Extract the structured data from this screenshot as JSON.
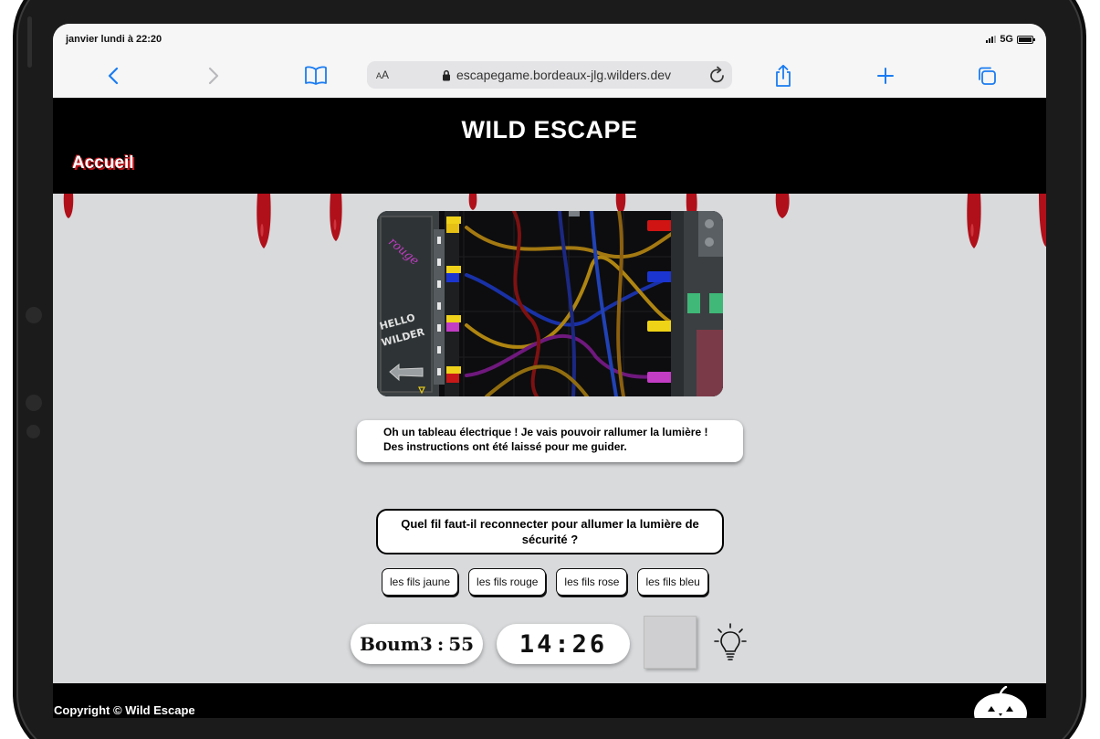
{
  "status_bar": {
    "time": "janvier lundi à 22:20",
    "network": "5G"
  },
  "browser": {
    "text_size_label": "AA",
    "url": "escapegame.bordeaux-jlg.wilders.dev",
    "icons": [
      "back-icon",
      "forward-icon",
      "bookmarks-icon",
      "lock-icon",
      "reload-icon",
      "share-icon",
      "new-tab-icon",
      "tabs-icon"
    ]
  },
  "header": {
    "title": "WILD ESCAPE",
    "home_link": "Accueil"
  },
  "scene": {
    "wall_tag": "rouge",
    "wall_note_line1": "HELLO",
    "wall_note_line2": "WILDER"
  },
  "dialog": {
    "line1": "Oh un tableau électrique ! Je vais pouvoir rallumer la lumière !",
    "line2": "Des instructions ont été laissé pour me guider."
  },
  "question": {
    "text": "Quel fil faut-il reconnecter pour allumer la lumière de sécurité ?"
  },
  "answers": [
    {
      "label": "les fils jaune"
    },
    {
      "label": "les fils rouge"
    },
    {
      "label": "les fils rose"
    },
    {
      "label": "les fils bleu"
    }
  ],
  "hud": {
    "boum_label": "Boum3",
    "boum_separator": ":",
    "boum_value": "55",
    "timer": "14:26",
    "hint_icon": "lightbulb-icon"
  },
  "footer": {
    "copyright": "Copyright © Wild Escape",
    "mascot_icon": "pumpkin-icon"
  },
  "colors": {
    "header_bg": "#000000",
    "page_bg": "#d8dadc",
    "blood_red": "#b0101a",
    "link_blue": "#1a7cf2"
  }
}
